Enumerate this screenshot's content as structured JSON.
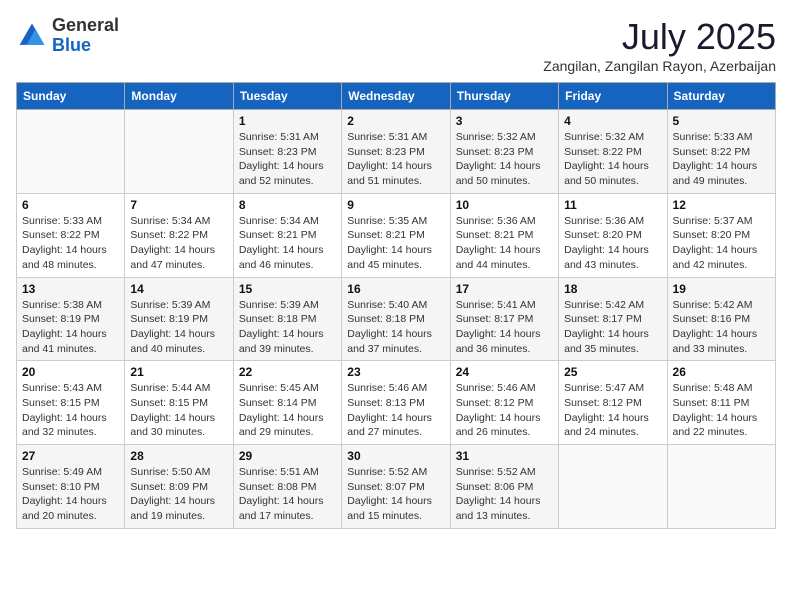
{
  "header": {
    "logo_general": "General",
    "logo_blue": "Blue",
    "month_title": "July 2025",
    "subtitle": "Zangilan, Zangilan Rayon, Azerbaijan"
  },
  "days_of_week": [
    "Sunday",
    "Monday",
    "Tuesday",
    "Wednesday",
    "Thursday",
    "Friday",
    "Saturday"
  ],
  "weeks": [
    [
      {
        "day": "",
        "detail": ""
      },
      {
        "day": "",
        "detail": ""
      },
      {
        "day": "1",
        "detail": "Sunrise: 5:31 AM\nSunset: 8:23 PM\nDaylight: 14 hours and 52 minutes."
      },
      {
        "day": "2",
        "detail": "Sunrise: 5:31 AM\nSunset: 8:23 PM\nDaylight: 14 hours and 51 minutes."
      },
      {
        "day": "3",
        "detail": "Sunrise: 5:32 AM\nSunset: 8:23 PM\nDaylight: 14 hours and 50 minutes."
      },
      {
        "day": "4",
        "detail": "Sunrise: 5:32 AM\nSunset: 8:22 PM\nDaylight: 14 hours and 50 minutes."
      },
      {
        "day": "5",
        "detail": "Sunrise: 5:33 AM\nSunset: 8:22 PM\nDaylight: 14 hours and 49 minutes."
      }
    ],
    [
      {
        "day": "6",
        "detail": "Sunrise: 5:33 AM\nSunset: 8:22 PM\nDaylight: 14 hours and 48 minutes."
      },
      {
        "day": "7",
        "detail": "Sunrise: 5:34 AM\nSunset: 8:22 PM\nDaylight: 14 hours and 47 minutes."
      },
      {
        "day": "8",
        "detail": "Sunrise: 5:34 AM\nSunset: 8:21 PM\nDaylight: 14 hours and 46 minutes."
      },
      {
        "day": "9",
        "detail": "Sunrise: 5:35 AM\nSunset: 8:21 PM\nDaylight: 14 hours and 45 minutes."
      },
      {
        "day": "10",
        "detail": "Sunrise: 5:36 AM\nSunset: 8:21 PM\nDaylight: 14 hours and 44 minutes."
      },
      {
        "day": "11",
        "detail": "Sunrise: 5:36 AM\nSunset: 8:20 PM\nDaylight: 14 hours and 43 minutes."
      },
      {
        "day": "12",
        "detail": "Sunrise: 5:37 AM\nSunset: 8:20 PM\nDaylight: 14 hours and 42 minutes."
      }
    ],
    [
      {
        "day": "13",
        "detail": "Sunrise: 5:38 AM\nSunset: 8:19 PM\nDaylight: 14 hours and 41 minutes."
      },
      {
        "day": "14",
        "detail": "Sunrise: 5:39 AM\nSunset: 8:19 PM\nDaylight: 14 hours and 40 minutes."
      },
      {
        "day": "15",
        "detail": "Sunrise: 5:39 AM\nSunset: 8:18 PM\nDaylight: 14 hours and 39 minutes."
      },
      {
        "day": "16",
        "detail": "Sunrise: 5:40 AM\nSunset: 8:18 PM\nDaylight: 14 hours and 37 minutes."
      },
      {
        "day": "17",
        "detail": "Sunrise: 5:41 AM\nSunset: 8:17 PM\nDaylight: 14 hours and 36 minutes."
      },
      {
        "day": "18",
        "detail": "Sunrise: 5:42 AM\nSunset: 8:17 PM\nDaylight: 14 hours and 35 minutes."
      },
      {
        "day": "19",
        "detail": "Sunrise: 5:42 AM\nSunset: 8:16 PM\nDaylight: 14 hours and 33 minutes."
      }
    ],
    [
      {
        "day": "20",
        "detail": "Sunrise: 5:43 AM\nSunset: 8:15 PM\nDaylight: 14 hours and 32 minutes."
      },
      {
        "day": "21",
        "detail": "Sunrise: 5:44 AM\nSunset: 8:15 PM\nDaylight: 14 hours and 30 minutes."
      },
      {
        "day": "22",
        "detail": "Sunrise: 5:45 AM\nSunset: 8:14 PM\nDaylight: 14 hours and 29 minutes."
      },
      {
        "day": "23",
        "detail": "Sunrise: 5:46 AM\nSunset: 8:13 PM\nDaylight: 14 hours and 27 minutes."
      },
      {
        "day": "24",
        "detail": "Sunrise: 5:46 AM\nSunset: 8:12 PM\nDaylight: 14 hours and 26 minutes."
      },
      {
        "day": "25",
        "detail": "Sunrise: 5:47 AM\nSunset: 8:12 PM\nDaylight: 14 hours and 24 minutes."
      },
      {
        "day": "26",
        "detail": "Sunrise: 5:48 AM\nSunset: 8:11 PM\nDaylight: 14 hours and 22 minutes."
      }
    ],
    [
      {
        "day": "27",
        "detail": "Sunrise: 5:49 AM\nSunset: 8:10 PM\nDaylight: 14 hours and 20 minutes."
      },
      {
        "day": "28",
        "detail": "Sunrise: 5:50 AM\nSunset: 8:09 PM\nDaylight: 14 hours and 19 minutes."
      },
      {
        "day": "29",
        "detail": "Sunrise: 5:51 AM\nSunset: 8:08 PM\nDaylight: 14 hours and 17 minutes."
      },
      {
        "day": "30",
        "detail": "Sunrise: 5:52 AM\nSunset: 8:07 PM\nDaylight: 14 hours and 15 minutes."
      },
      {
        "day": "31",
        "detail": "Sunrise: 5:52 AM\nSunset: 8:06 PM\nDaylight: 14 hours and 13 minutes."
      },
      {
        "day": "",
        "detail": ""
      },
      {
        "day": "",
        "detail": ""
      }
    ]
  ]
}
